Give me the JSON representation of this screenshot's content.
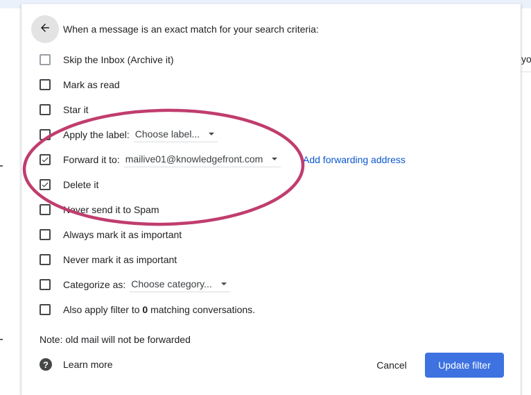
{
  "dialog": {
    "header": "When a message is an exact match for your search criteria:",
    "options": [
      {
        "label": "Skip the Inbox (Archive it)",
        "checked": false,
        "disabled": true
      },
      {
        "label": "Mark as read",
        "checked": false
      },
      {
        "label": "Star it",
        "checked": false
      },
      {
        "label": "Apply the label:",
        "checked": false,
        "select": "Choose label..."
      },
      {
        "label": "Forward it to:",
        "checked": true,
        "select": "mailive01@knowledgefront.com"
      },
      {
        "label": "Delete it",
        "checked": true
      },
      {
        "label": "Never send it to Spam",
        "checked": false
      },
      {
        "label": "Always mark it as important",
        "checked": false
      },
      {
        "label": "Never mark it as important",
        "checked": false
      },
      {
        "label": "Categorize as:",
        "checked": false,
        "select": "Choose category..."
      },
      {
        "label_prefix": "Also apply filter to ",
        "count": "0",
        "label_suffix": " matching conversations.",
        "checked": false
      }
    ],
    "add_forwarding_link": "Add forwarding address",
    "note": "Note: old mail will not be forwarded",
    "learn_more": "Learn more",
    "cancel": "Cancel",
    "update": "Update filter"
  },
  "background": {
    "right_text": "yo"
  },
  "colors": {
    "accent": "#3d72e0",
    "link": "#0b57d0",
    "annotation": "#c03d6e"
  }
}
